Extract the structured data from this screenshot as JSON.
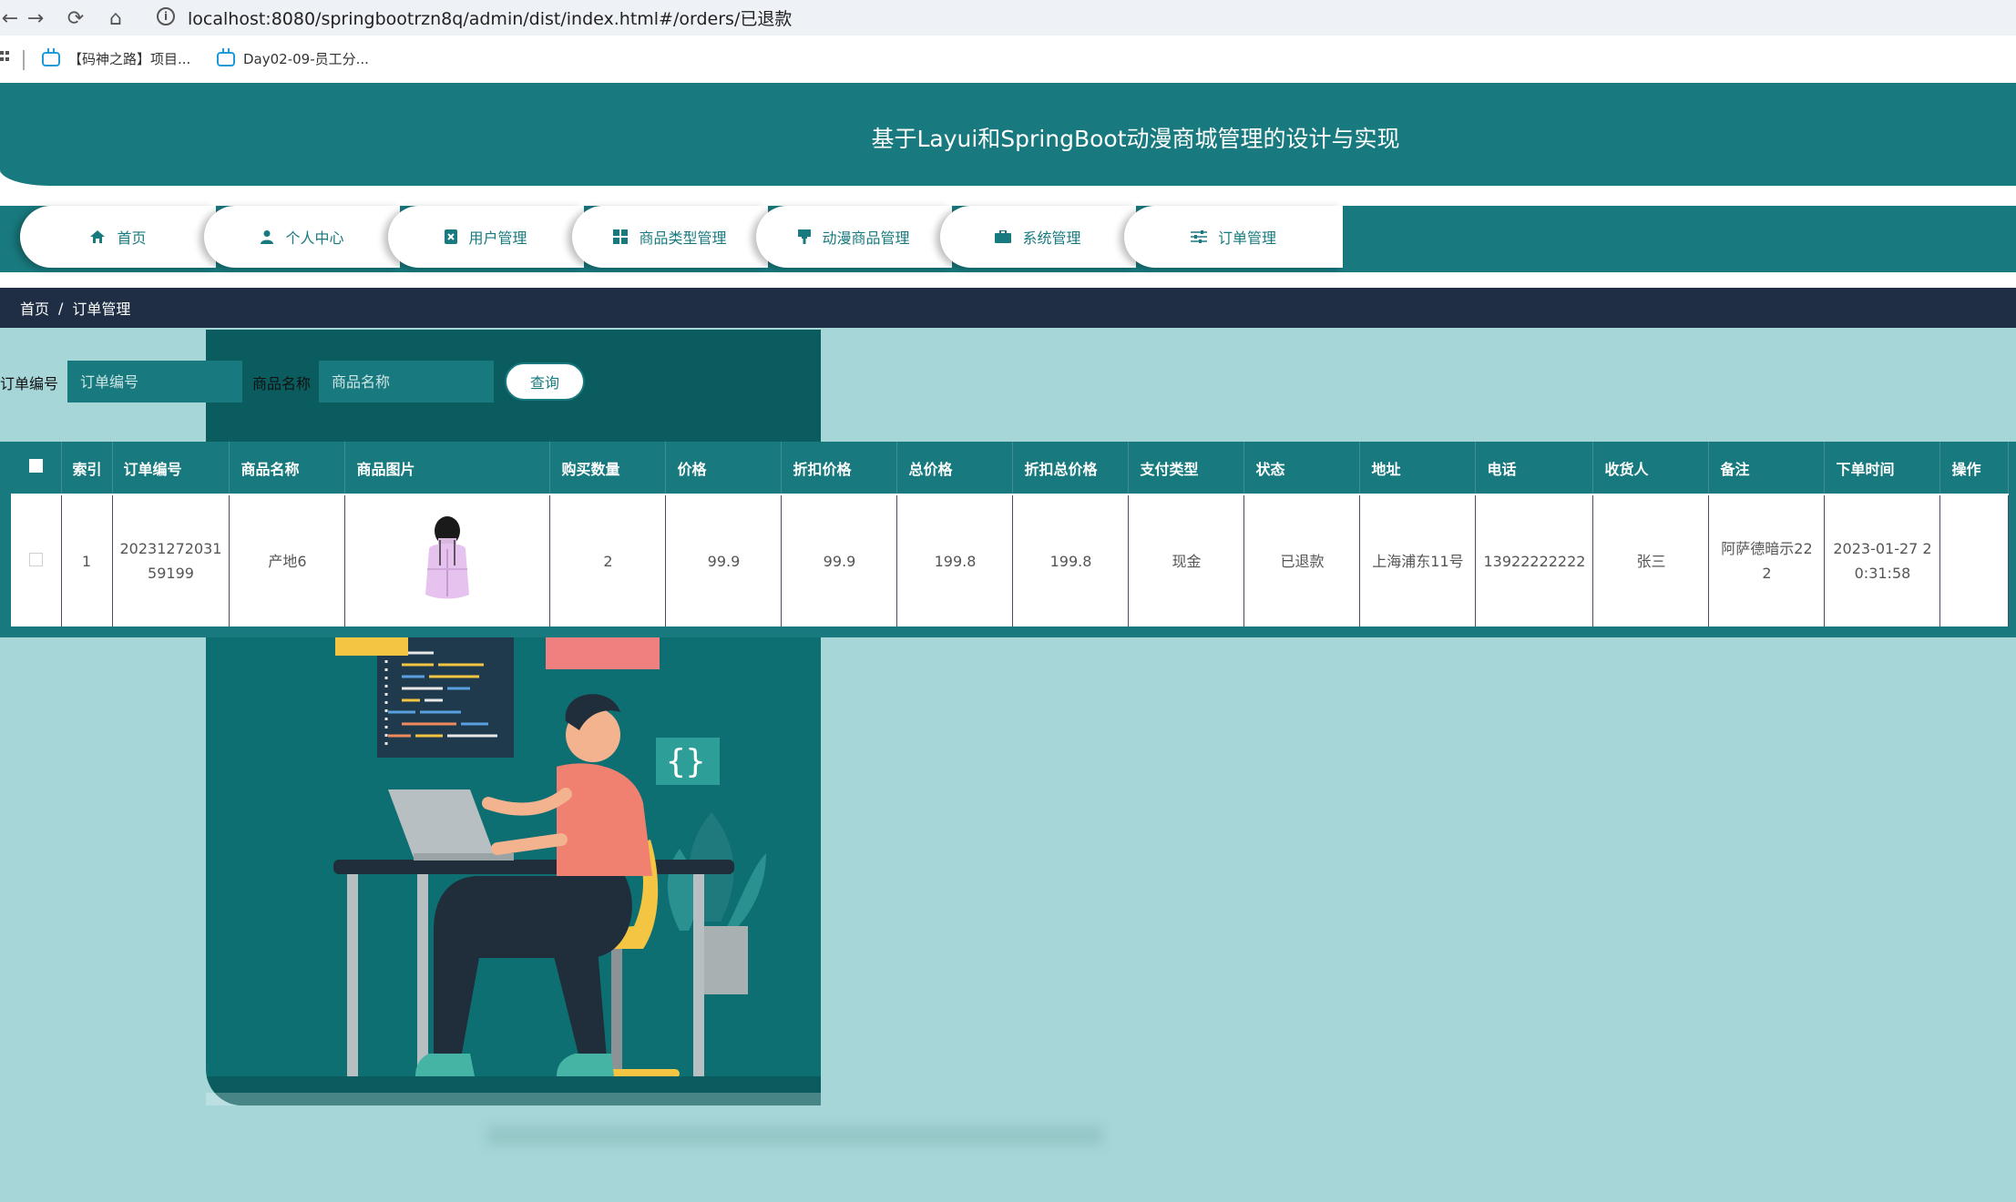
{
  "browser": {
    "url": "localhost:8080/springbootrzn8q/admin/dist/index.html#/orders/已退款",
    "bookmarks": [
      "【码神之路】项目...",
      "Day02-09-员工分..."
    ]
  },
  "header": {
    "title": "基于Layui和SpringBoot动漫商城管理的设计与实现"
  },
  "menu": [
    {
      "label": "首页",
      "icon": "home-icon"
    },
    {
      "label": "个人中心",
      "icon": "user-icon"
    },
    {
      "label": "用户管理",
      "icon": "user-card-icon"
    },
    {
      "label": "商品类型管理",
      "icon": "grid-icon"
    },
    {
      "label": "动漫商品管理",
      "icon": "brush-icon"
    },
    {
      "label": "系统管理",
      "icon": "briefcase-icon"
    },
    {
      "label": "订单管理",
      "icon": "sliders-icon"
    }
  ],
  "breadcrumb": {
    "home": "首页",
    "separator": "/",
    "current": "订单管理"
  },
  "search": {
    "order_no_label": "订单编号",
    "order_no_placeholder": "订单编号",
    "product_name_label": "商品名称",
    "product_name_placeholder": "商品名称",
    "button": "查询"
  },
  "table": {
    "columns": [
      "索引",
      "订单编号",
      "商品名称",
      "商品图片",
      "购买数量",
      "价格",
      "折扣价格",
      "总价格",
      "折扣总价格",
      "支付类型",
      "状态",
      "地址",
      "电话",
      "收货人",
      "备注",
      "下单时间",
      "操作"
    ],
    "rows": [
      {
        "index": "1",
        "order_no_1": "20231272031",
        "order_no_2": "59199",
        "product_name": "产地6",
        "quantity": "2",
        "price": "99.9",
        "discount_price": "99.9",
        "total_price": "199.8",
        "discount_total": "199.8",
        "pay_type": "现金",
        "status": "已退款",
        "address": "上海浦东11号",
        "phone": "13922222222",
        "receiver": "张三",
        "remark_1": "阿萨德暗示22",
        "remark_2": "2",
        "time_1": "2023-01-27 2",
        "time_2": "0:31:58"
      }
    ]
  },
  "colors": {
    "primary": "#187a7e",
    "breadcrumb_bg": "#1f2e44",
    "page_bg": "#a6d6d7"
  }
}
